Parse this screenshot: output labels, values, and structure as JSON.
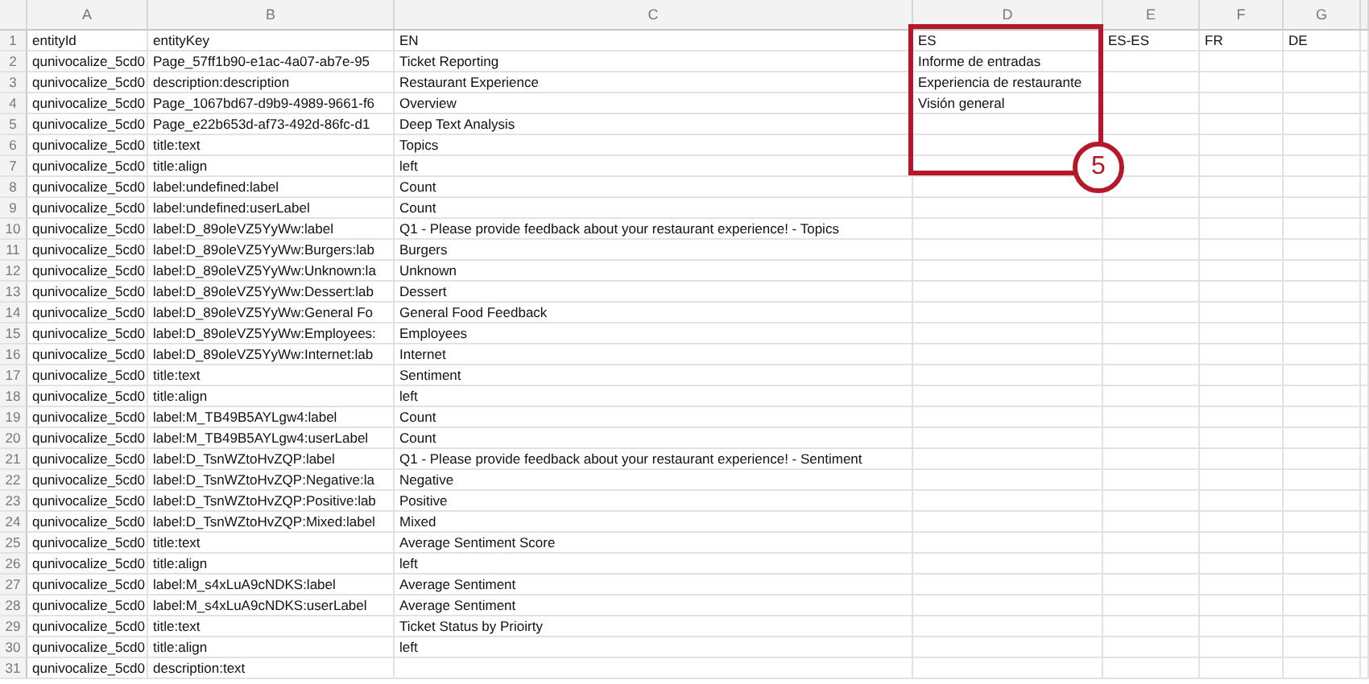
{
  "columns": [
    "A",
    "B",
    "C",
    "D",
    "E",
    "F",
    "G"
  ],
  "rows": [
    {
      "number": "1",
      "cells": [
        "entityId",
        "entityKey",
        "EN",
        "ES",
        "ES-ES",
        "FR",
        "DE"
      ]
    },
    {
      "number": "2",
      "cells": [
        "qunivocalize_5cd0",
        "Page_57ff1b90-e1ac-4a07-ab7e-95",
        "Ticket Reporting",
        "Informe de entradas",
        null,
        null,
        null
      ]
    },
    {
      "number": "3",
      "cells": [
        "qunivocalize_5cd0",
        "description:description",
        "Restaurant Experience",
        "Experiencia de restaurante",
        null,
        null,
        null
      ]
    },
    {
      "number": "4",
      "cells": [
        "qunivocalize_5cd0",
        "Page_1067bd67-d9b9-4989-9661-f6",
        "Overview",
        "Visión general",
        null,
        null,
        null
      ]
    },
    {
      "number": "5",
      "cells": [
        "qunivocalize_5cd0",
        "Page_e22b653d-af73-492d-86fc-d1",
        "Deep Text Analysis",
        null,
        null,
        null,
        null
      ]
    },
    {
      "number": "6",
      "cells": [
        "qunivocalize_5cd0",
        "title:text",
        "Topics",
        null,
        null,
        null,
        null
      ]
    },
    {
      "number": "7",
      "cells": [
        "qunivocalize_5cd0",
        "title:align",
        "left",
        null,
        null,
        null,
        null
      ]
    },
    {
      "number": "8",
      "cells": [
        "qunivocalize_5cd0",
        "label:undefined:label",
        "Count",
        null,
        null,
        null,
        null
      ]
    },
    {
      "number": "9",
      "cells": [
        "qunivocalize_5cd0",
        "label:undefined:userLabel",
        "Count",
        null,
        null,
        null,
        null
      ]
    },
    {
      "number": "10",
      "cells": [
        "qunivocalize_5cd0",
        "label:D_89oleVZ5YyWw:label",
        "Q1 - Please provide feedback about your restaurant experience! - Topics",
        null,
        null,
        null,
        null
      ]
    },
    {
      "number": "11",
      "cells": [
        "qunivocalize_5cd0",
        "label:D_89oleVZ5YyWw:Burgers:lab",
        "Burgers",
        null,
        null,
        null,
        null
      ]
    },
    {
      "number": "12",
      "cells": [
        "qunivocalize_5cd0",
        "label:D_89oleVZ5YyWw:Unknown:la",
        "Unknown",
        null,
        null,
        null,
        null
      ]
    },
    {
      "number": "13",
      "cells": [
        "qunivocalize_5cd0",
        "label:D_89oleVZ5YyWw:Dessert:lab",
        "Dessert",
        null,
        null,
        null,
        null
      ]
    },
    {
      "number": "14",
      "cells": [
        "qunivocalize_5cd0",
        "label:D_89oleVZ5YyWw:General Fo",
        "General Food Feedback",
        null,
        null,
        null,
        null
      ]
    },
    {
      "number": "15",
      "cells": [
        "qunivocalize_5cd0",
        "label:D_89oleVZ5YyWw:Employees:",
        "Employees",
        null,
        null,
        null,
        null
      ]
    },
    {
      "number": "16",
      "cells": [
        "qunivocalize_5cd0",
        "label:D_89oleVZ5YyWw:Internet:lab",
        "Internet",
        null,
        null,
        null,
        null
      ]
    },
    {
      "number": "17",
      "cells": [
        "qunivocalize_5cd0",
        "title:text",
        "Sentiment",
        null,
        null,
        null,
        null
      ]
    },
    {
      "number": "18",
      "cells": [
        "qunivocalize_5cd0",
        "title:align",
        "left",
        null,
        null,
        null,
        null
      ]
    },
    {
      "number": "19",
      "cells": [
        "qunivocalize_5cd0",
        "label:M_TB49B5AYLgw4:label",
        "Count",
        null,
        null,
        null,
        null
      ]
    },
    {
      "number": "20",
      "cells": [
        "qunivocalize_5cd0",
        "label:M_TB49B5AYLgw4:userLabel",
        "Count",
        null,
        null,
        null,
        null
      ]
    },
    {
      "number": "21",
      "cells": [
        "qunivocalize_5cd0",
        "label:D_TsnWZtoHvZQP:label",
        "Q1 - Please provide feedback about your restaurant experience! - Sentiment",
        null,
        null,
        null,
        null
      ]
    },
    {
      "number": "22",
      "cells": [
        "qunivocalize_5cd0",
        "label:D_TsnWZtoHvZQP:Negative:la",
        "Negative",
        null,
        null,
        null,
        null
      ]
    },
    {
      "number": "23",
      "cells": [
        "qunivocalize_5cd0",
        "label:D_TsnWZtoHvZQP:Positive:lab",
        "Positive",
        null,
        null,
        null,
        null
      ]
    },
    {
      "number": "24",
      "cells": [
        "qunivocalize_5cd0",
        "label:D_TsnWZtoHvZQP:Mixed:label",
        "Mixed",
        null,
        null,
        null,
        null
      ]
    },
    {
      "number": "25",
      "cells": [
        "qunivocalize_5cd0",
        "title:text",
        "Average Sentiment Score",
        null,
        null,
        null,
        null
      ]
    },
    {
      "number": "26",
      "cells": [
        "qunivocalize_5cd0",
        "title:align",
        "left",
        null,
        null,
        null,
        null
      ]
    },
    {
      "number": "27",
      "cells": [
        "qunivocalize_5cd0",
        "label:M_s4xLuA9cNDKS:label",
        "Average Sentiment",
        null,
        null,
        null,
        null
      ]
    },
    {
      "number": "28",
      "cells": [
        "qunivocalize_5cd0",
        "label:M_s4xLuA9cNDKS:userLabel",
        "Average Sentiment",
        null,
        null,
        null,
        null
      ]
    },
    {
      "number": "29",
      "cells": [
        "qunivocalize_5cd0",
        "title:text",
        "Ticket Status by Prioirty",
        null,
        null,
        null,
        null
      ]
    },
    {
      "number": "30",
      "cells": [
        "qunivocalize_5cd0",
        "title:align",
        "left",
        null,
        null,
        null,
        null
      ]
    },
    {
      "number": "31",
      "cells": [
        "qunivocalize_5cd0",
        "description:text",
        null,
        null,
        null,
        null,
        null
      ]
    }
  ],
  "callout": {
    "number": "5"
  }
}
